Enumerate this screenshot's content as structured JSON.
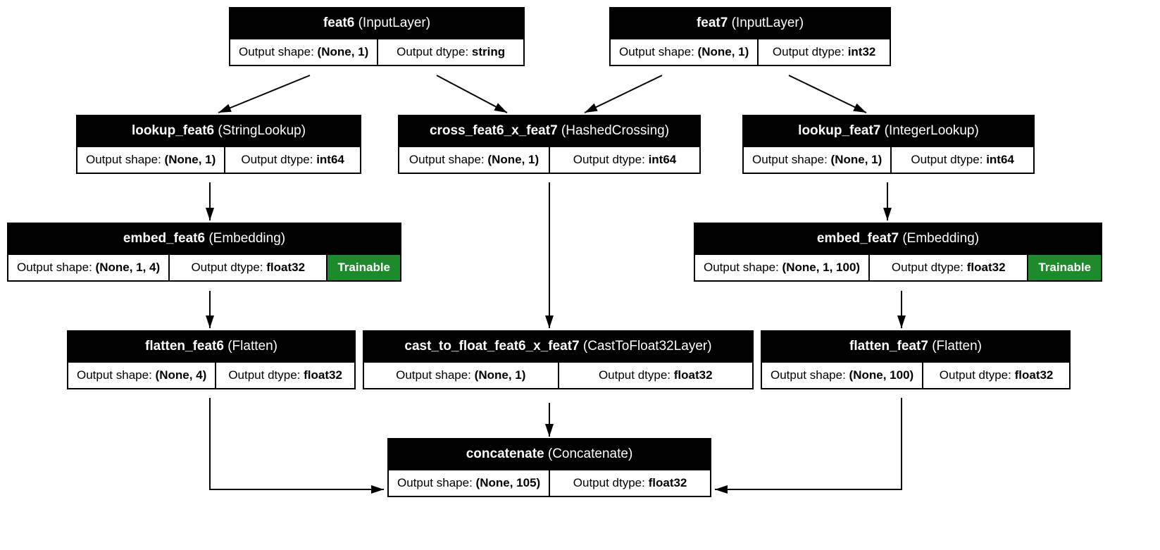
{
  "labels": {
    "output_shape": "Output shape:",
    "output_dtype": "Output dtype:",
    "trainable": "Trainable"
  },
  "nodes": {
    "feat6": {
      "name": "feat6",
      "type": "(InputLayer)",
      "shape": "(None, 1)",
      "dtype": "string"
    },
    "feat7": {
      "name": "feat7",
      "type": "(InputLayer)",
      "shape": "(None, 1)",
      "dtype": "int32"
    },
    "lookup_feat6": {
      "name": "lookup_feat6",
      "type": "(StringLookup)",
      "shape": "(None, 1)",
      "dtype": "int64"
    },
    "cross": {
      "name": "cross_feat6_x_feat7",
      "type": "(HashedCrossing)",
      "shape": "(None, 1)",
      "dtype": "int64"
    },
    "lookup_feat7": {
      "name": "lookup_feat7",
      "type": "(IntegerLookup)",
      "shape": "(None, 1)",
      "dtype": "int64"
    },
    "embed_feat6": {
      "name": "embed_feat6",
      "type": "(Embedding)",
      "shape": "(None, 1, 4)",
      "dtype": "float32"
    },
    "embed_feat7": {
      "name": "embed_feat7",
      "type": "(Embedding)",
      "shape": "(None, 1, 100)",
      "dtype": "float32"
    },
    "flatten_feat6": {
      "name": "flatten_feat6",
      "type": "(Flatten)",
      "shape": "(None, 4)",
      "dtype": "float32"
    },
    "cast": {
      "name": "cast_to_float_feat6_x_feat7",
      "type": "(CastToFloat32Layer)",
      "shape": "(None, 1)",
      "dtype": "float32"
    },
    "flatten_feat7": {
      "name": "flatten_feat7",
      "type": "(Flatten)",
      "shape": "(None, 100)",
      "dtype": "float32"
    },
    "concat": {
      "name": "concatenate",
      "type": "(Concatenate)",
      "shape": "(None, 105)",
      "dtype": "float32"
    }
  },
  "chart_data": {
    "type": "graph",
    "nodes": [
      "feat6",
      "feat7",
      "lookup_feat6",
      "cross_feat6_x_feat7",
      "lookup_feat7",
      "embed_feat6",
      "embed_feat7",
      "flatten_feat6",
      "cast_to_float_feat6_x_feat7",
      "flatten_feat7",
      "concatenate"
    ],
    "edges": [
      [
        "feat6",
        "lookup_feat6"
      ],
      [
        "feat6",
        "cross_feat6_x_feat7"
      ],
      [
        "feat7",
        "cross_feat6_x_feat7"
      ],
      [
        "feat7",
        "lookup_feat7"
      ],
      [
        "lookup_feat6",
        "embed_feat6"
      ],
      [
        "lookup_feat7",
        "embed_feat7"
      ],
      [
        "embed_feat6",
        "flatten_feat6"
      ],
      [
        "cross_feat6_x_feat7",
        "cast_to_float_feat6_x_feat7"
      ],
      [
        "embed_feat7",
        "flatten_feat7"
      ],
      [
        "flatten_feat6",
        "concatenate"
      ],
      [
        "cast_to_float_feat6_x_feat7",
        "concatenate"
      ],
      [
        "flatten_feat7",
        "concatenate"
      ]
    ]
  }
}
